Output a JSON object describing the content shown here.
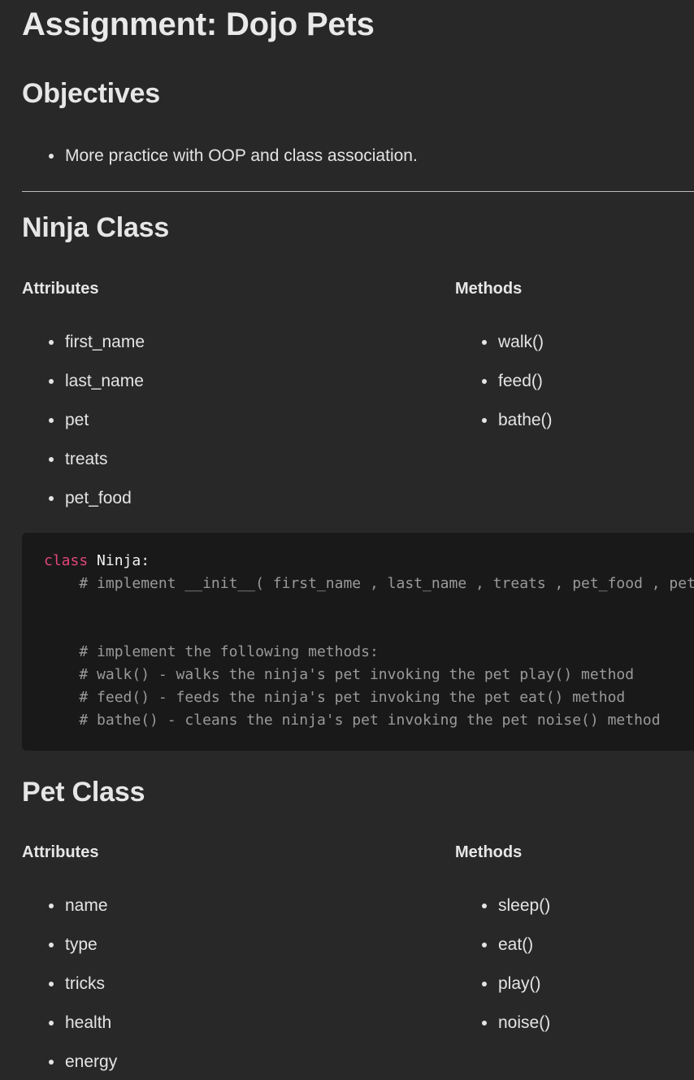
{
  "page_title": "Assignment: Dojo Pets",
  "objectives": {
    "heading": "Objectives",
    "items": [
      "More practice with OOP and class association."
    ]
  },
  "ninja": {
    "heading": "Ninja Class",
    "attributes_heading": "Attributes",
    "attributes": [
      "first_name",
      "last_name",
      "pet",
      "treats",
      "pet_food"
    ],
    "methods_heading": "Methods",
    "methods": [
      "walk()",
      "feed()",
      "bathe()"
    ],
    "code": {
      "keyword": "class",
      "class_decl": "Ninja:",
      "lines": [
        "    # implement __init__( first_name , last_name , treats , pet_food , pet )",
        "",
        "",
        "    # implement the following methods:",
        "    # walk() - walks the ninja's pet invoking the pet play() method",
        "    # feed() - feeds the ninja's pet invoking the pet eat() method",
        "    # bathe() - cleans the ninja's pet invoking the pet noise() method"
      ]
    }
  },
  "pet": {
    "heading": "Pet Class",
    "attributes_heading": "Attributes",
    "attributes": [
      "name",
      "type",
      "tricks",
      "health",
      "energy"
    ],
    "methods_heading": "Methods",
    "methods": [
      "sleep()",
      "eat()",
      "play()",
      "noise()"
    ]
  }
}
